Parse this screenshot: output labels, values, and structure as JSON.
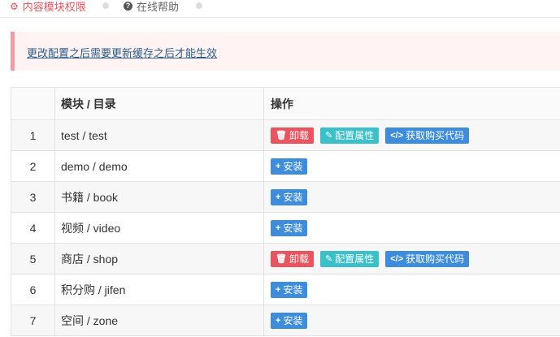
{
  "tabs": {
    "active_label": "内容模块权限",
    "help_label": "在线帮助"
  },
  "notice": {
    "text": "更改配置之后需要更新缓存之后才能生效"
  },
  "table": {
    "headers": [
      "",
      "模块 / 目录",
      "操作"
    ],
    "rows": [
      {
        "idx": "1",
        "module": "test / test",
        "installed": true
      },
      {
        "idx": "2",
        "module": "demo / demo",
        "installed": false
      },
      {
        "idx": "3",
        "module": "书籍 / book",
        "installed": false
      },
      {
        "idx": "4",
        "module": "视频 / video",
        "installed": false
      },
      {
        "idx": "5",
        "module": "商店 / shop",
        "installed": true
      },
      {
        "idx": "6",
        "module": "积分购 / jifen",
        "installed": false
      },
      {
        "idx": "7",
        "module": "空间 / zone",
        "installed": false
      }
    ]
  },
  "actions": {
    "uninstall_label": "卸载",
    "config_label": "配置属性",
    "code_label": "获取购买代码",
    "install_label": "安装"
  },
  "icons": {
    "uninstall": "trash-icon",
    "config": "edit-icon",
    "code": "code-icon",
    "install": "plus-icon"
  },
  "colors": {
    "danger": "#e9545e",
    "info": "#3bbfc9",
    "primary": "#3d8ddc"
  }
}
